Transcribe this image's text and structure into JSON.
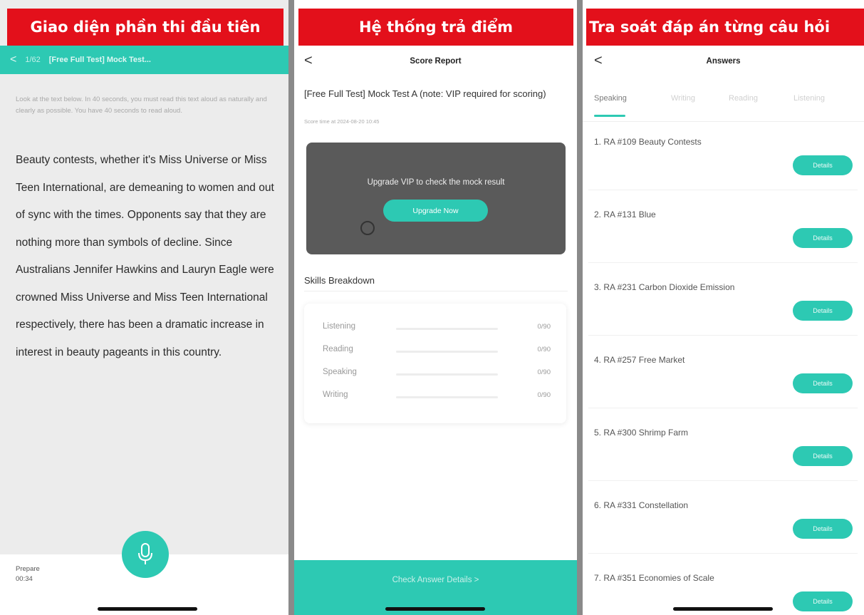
{
  "panel1": {
    "banner": "Giao diện phần thi đầu tiên",
    "nav": {
      "back_glyph": "<",
      "number": "1/62",
      "title": "[Free Full Test] Mock Test..."
    },
    "instruction": "Look at the text below. In 40 seconds, you must read this text aloud as naturally and clearly as possible. You have 40 seconds to read aloud.",
    "passage": "Beauty contests, whether it's Miss Universe or Miss Teen International, are demeaning to women and out of sync with the times. Opponents say that they are nothing more than symbols of decline. Since Australians Jennifer Hawkins and Lauryn Eagle were crowned Miss Universe and Miss Teen International respectively, there has been a dramatic increase in interest in beauty pageants in this country.",
    "prepare_label": "Prepare",
    "prepare_time": "00:34",
    "mic_icon": "microphone-icon"
  },
  "panel2": {
    "banner": "Hệ thống trả điểm",
    "header": {
      "back_glyph": "<",
      "title": "Score Report"
    },
    "test_title": "[Free Full Test] Mock Test A (note: VIP required for scoring)",
    "score_time": "Score time at 2024-08-20 10:45",
    "vip_message": "Upgrade VIP to check the mock result",
    "upgrade_button": "Upgrade Now",
    "skills_title": "Skills Breakdown",
    "skills": [
      {
        "name": "Listening",
        "score": "0/90",
        "progress": 0
      },
      {
        "name": "Reading",
        "score": "0/90",
        "progress": 0
      },
      {
        "name": "Speaking",
        "score": "0/90",
        "progress": 0
      },
      {
        "name": "Writing",
        "score": "0/90",
        "progress": 0
      }
    ],
    "check_button": "Check Answer Details >"
  },
  "panel3": {
    "banner": "Tra soát đáp án từng câu hỏi",
    "header": {
      "back_glyph": "<",
      "title": "Answers"
    },
    "tabs": [
      "Speaking",
      "Writing",
      "Reading",
      "Listening"
    ],
    "active_tab": "Speaking",
    "items": [
      {
        "label": "1. RA #109 Beauty Contests",
        "button": "Details"
      },
      {
        "label": "2. RA #131 Blue",
        "button": "Details"
      },
      {
        "label": "3. RA #231 Carbon Dioxide Emission",
        "button": "Details"
      },
      {
        "label": "4. RA #257 Free Market",
        "button": "Details"
      },
      {
        "label": "5. RA #300 Shrimp Farm",
        "button": "Details"
      },
      {
        "label": "6. RA #331 Constellation",
        "button": "Details"
      },
      {
        "label": "7. RA #351 Economies of Scale",
        "button": "Details"
      }
    ]
  },
  "colors": {
    "accent": "#2dc9b3",
    "banner": "#e3101b",
    "vip_card": "#5a5a5a"
  }
}
